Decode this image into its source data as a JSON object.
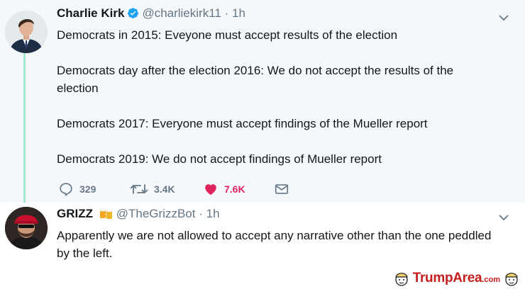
{
  "tweet1": {
    "name": "Charlie Kirk",
    "handle": "@charliekirk11",
    "separator": "·",
    "time": "1h",
    "paragraphs": [
      "Democrats in 2015: Eveyone must accept results of the election",
      "Democrats day after the election 2016: We do not accept the results of the election",
      "Democrats 2017: Everyone must accept findings of the Mueller report",
      "Democrats 2019: We do not accept findings of Mueller report"
    ],
    "replies": "329",
    "retweets": "3.4K",
    "likes": "7.6K"
  },
  "tweet2": {
    "name": "GRIZZ",
    "handle": "@TheGrizzBot",
    "separator": "·",
    "time": "1h",
    "text": "Apparently we are not allowed to accept any narrative other than the one peddled by the left."
  },
  "watermark": {
    "brand": "TrumpArea",
    "tld": ".com"
  },
  "colors": {
    "verified": "#1da1f2",
    "like": "#e0245e",
    "thread_line": "#a3e8cf",
    "muted": "#657786",
    "brand": "#c41e1e"
  },
  "icons": [
    "verified-badge-icon",
    "chevron-down-icon",
    "reply-icon",
    "retweet-icon",
    "heart-icon",
    "direct-message-icon",
    "beer-mugs-emoji"
  ]
}
